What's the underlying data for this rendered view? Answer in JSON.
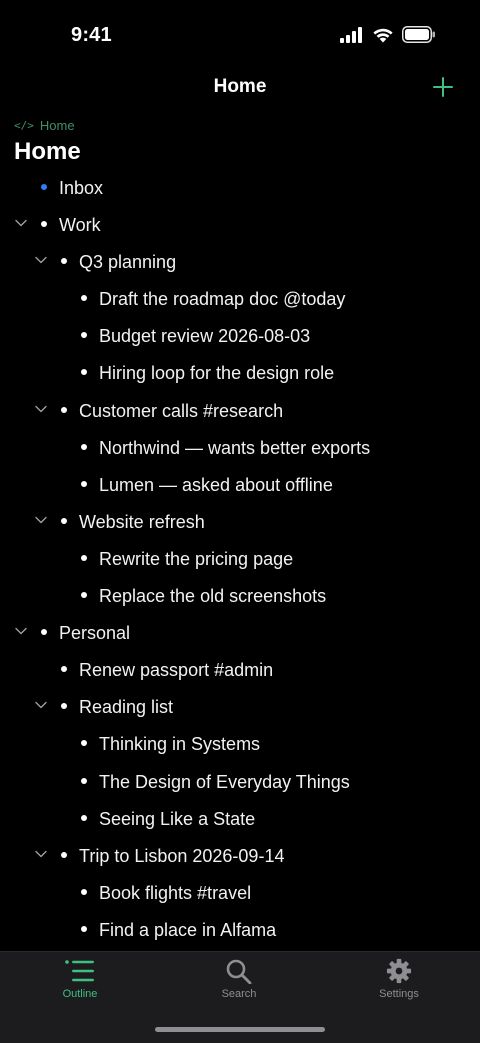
{
  "status_bar": {
    "time": "9:41"
  },
  "nav": {
    "title": "Home",
    "add_icon": "plus-icon"
  },
  "breadcrumb": {
    "icon": "</>",
    "label": "Home"
  },
  "page_title": "Home",
  "colors": {
    "accent": "#3fbf82",
    "inbox_bullet": "#2f7ef6",
    "background": "#000000",
    "tab_bar": "#1c1c1e"
  },
  "outline": {
    "items": [
      {
        "text": "Inbox",
        "depth": 0,
        "collapsible": false,
        "accent_bullet": true
      },
      {
        "text": "Work",
        "depth": 0,
        "collapsible": true
      },
      {
        "text": "Q3 planning",
        "depth": 1,
        "collapsible": true
      },
      {
        "text": "Draft the roadmap doc @today",
        "depth": 2,
        "collapsible": false
      },
      {
        "text": "Budget review 2026-08-03",
        "depth": 2,
        "collapsible": false
      },
      {
        "text": "Hiring loop for the design role",
        "depth": 2,
        "collapsible": false
      },
      {
        "text": "Customer calls #research",
        "depth": 1,
        "collapsible": true
      },
      {
        "text": "Northwind — wants better exports",
        "depth": 2,
        "collapsible": false
      },
      {
        "text": "Lumen — asked about offline",
        "depth": 2,
        "collapsible": false
      },
      {
        "text": "Website refresh",
        "depth": 1,
        "collapsible": true
      },
      {
        "text": "Rewrite the pricing page",
        "depth": 2,
        "collapsible": false
      },
      {
        "text": "Replace the old screenshots",
        "depth": 2,
        "collapsible": false
      },
      {
        "text": "Personal",
        "depth": 0,
        "collapsible": true
      },
      {
        "text": "Renew passport #admin",
        "depth": 1,
        "collapsible": false
      },
      {
        "text": "Reading list",
        "depth": 1,
        "collapsible": true
      },
      {
        "text": "Thinking in Systems",
        "depth": 2,
        "collapsible": false
      },
      {
        "text": "The Design of Everyday Things",
        "depth": 2,
        "collapsible": false
      },
      {
        "text": "Seeing Like a State",
        "depth": 2,
        "collapsible": false
      },
      {
        "text": "Trip to Lisbon 2026-09-14",
        "depth": 1,
        "collapsible": true
      },
      {
        "text": "Book flights #travel",
        "depth": 2,
        "collapsible": false
      },
      {
        "text": "Find a place in Alfama",
        "depth": 2,
        "collapsible": false
      }
    ]
  },
  "tab_bar": {
    "tabs": [
      {
        "label": "Outline",
        "icon": "list-icon",
        "active": true
      },
      {
        "label": "Search",
        "icon": "search-icon",
        "active": false
      },
      {
        "label": "Settings",
        "icon": "gear-icon",
        "active": false
      }
    ]
  }
}
